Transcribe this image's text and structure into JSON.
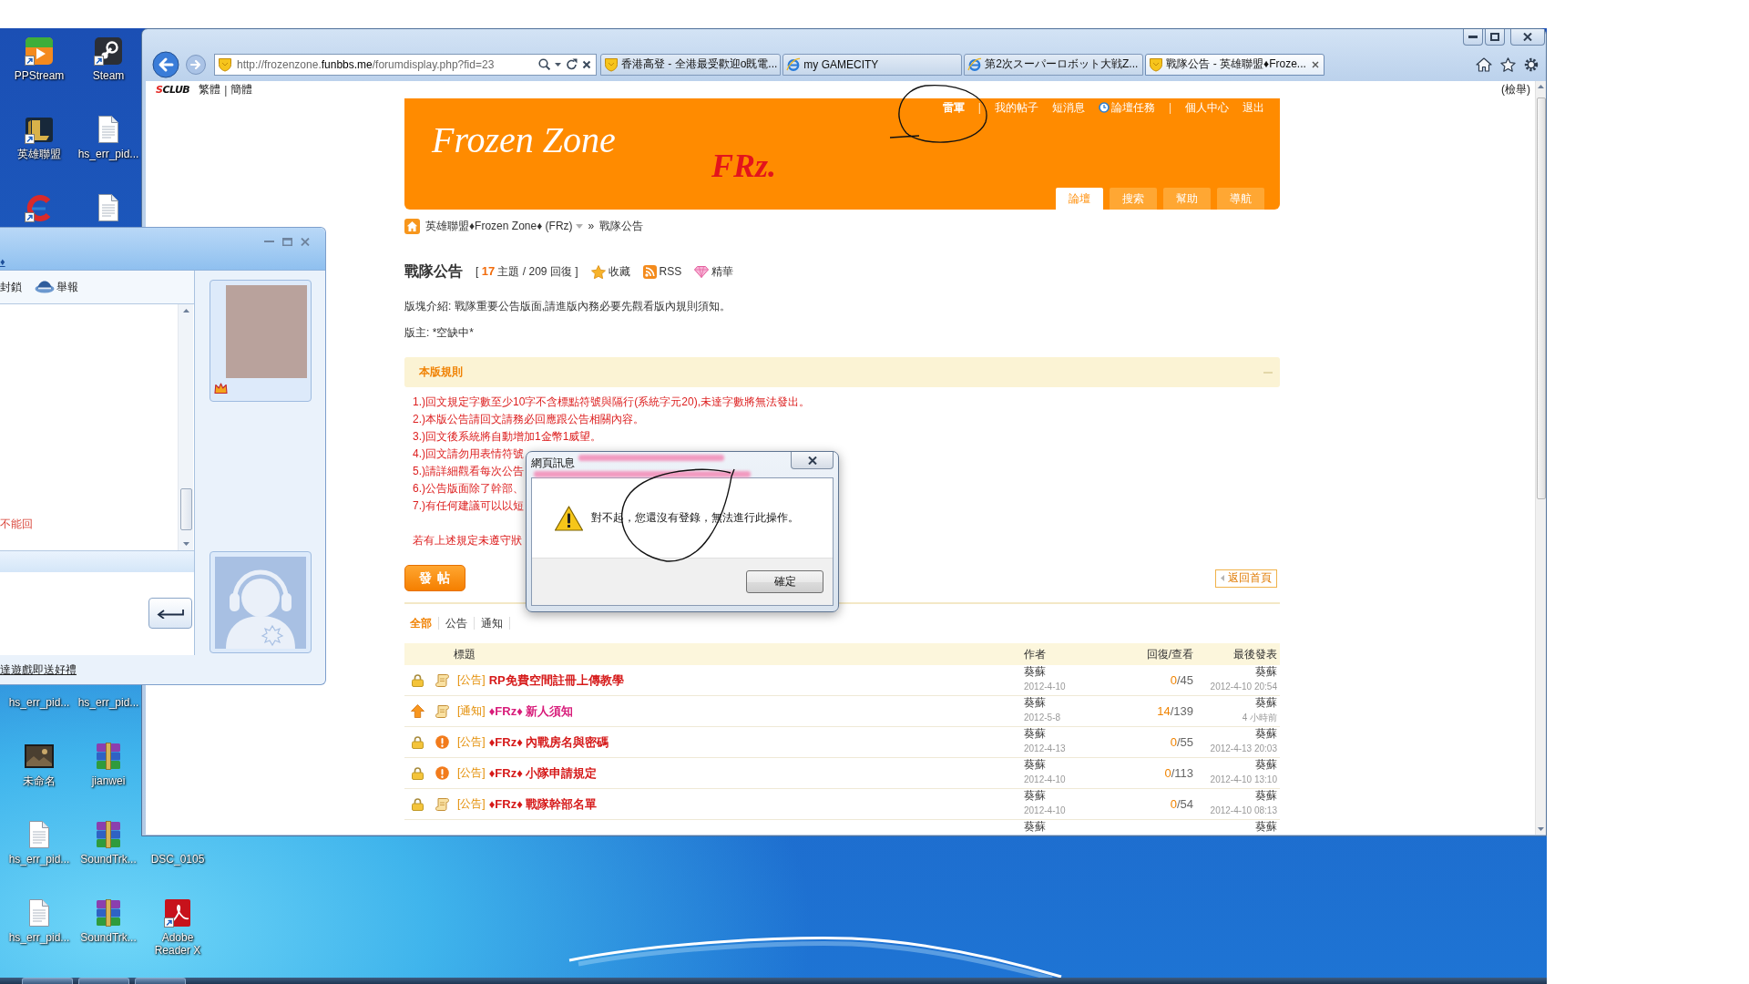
{
  "desktop": {
    "icons": [
      {
        "label": "PPStream",
        "kind": "player"
      },
      {
        "label": "Steam",
        "kind": "steam"
      },
      {
        "label": "英雄聯盟",
        "kind": "emblem"
      },
      {
        "label": "hs_err_pid...",
        "kind": "document"
      },
      {
        "kind": "cleaner"
      },
      {
        "kind": "document"
      },
      {
        "label": "hs_err_pid..."
      },
      {
        "label": "hs_err_pid..."
      },
      {
        "label": "未命名",
        "kind": "image"
      },
      {
        "label": "jianwei",
        "kind": "archive"
      },
      {
        "label": "hs_err_pid...",
        "kind": "document"
      },
      {
        "label": "SoundTrk...",
        "kind": "archive"
      },
      {
        "label": "DSC_0105"
      },
      {
        "label": "hs_err_pid...",
        "kind": "document"
      },
      {
        "label": "SoundTrk...",
        "kind": "archive"
      },
      {
        "label": "Adobe Reader X",
        "kind": "pdf"
      }
    ]
  },
  "browser": {
    "url": "http://frozenzone.**funbbs.me**/forumdisplay.php?fid=23",
    "tabs": [
      {
        "label": "香港高登 - 全港最受歡迎o既電...",
        "kind": "site",
        "selected": false
      },
      {
        "label": "my GAMECITY",
        "kind": "ie",
        "selected": false
      },
      {
        "label": "第2次スーパーロボット大戦Z...",
        "kind": "ie",
        "selected": false
      },
      {
        "label": "戰隊公告 - 英雄聯盟♦Froze...",
        "kind": "site",
        "selected": true
      }
    ],
    "toolbar": {
      "logo": "SCLUB",
      "links": [
        "繁體",
        "簡體"
      ],
      "separator": "|",
      "report": "(檢舉)"
    }
  },
  "forum": {
    "logo": "Frozen Zone",
    "tagline": "FRz.",
    "user_links": [
      {
        "kind": "user",
        "label": "雷軍"
      },
      {
        "kind": "separator",
        "label": "|"
      },
      {
        "kind": "link",
        "label": "我的帖子"
      },
      {
        "kind": "link",
        "label": "短消息"
      },
      {
        "kind": "task",
        "label": "論壇任務"
      },
      {
        "kind": "separator",
        "label": "|"
      },
      {
        "kind": "link",
        "label": "個人中心"
      },
      {
        "kind": "link",
        "label": "退出"
      }
    ],
    "nav": [
      {
        "label": "論壇",
        "selected": true
      },
      {
        "label": "搜索",
        "selected": false
      },
      {
        "label": "幫助",
        "selected": false
      },
      {
        "label": "導航",
        "selected": false
      }
    ],
    "breadcrumb": {
      "items": [
        "英雄聯盟♦Frozen Zone♦ (FRz)",
        "戰隊公告"
      ],
      "separator": "»"
    },
    "title": "戰隊公告",
    "stats": "[ **17** 主題 / 209 回復 ]",
    "actions": [
      {
        "label": "收藏",
        "kind": "star"
      },
      {
        "label": "RSS",
        "kind": "rss"
      },
      {
        "label": "精華",
        "kind": "gem"
      }
    ],
    "intro": "版塊介紹: 戰隊重要公告版面,請進版內務必要先觀看版內規則須知。",
    "moderator": "版主: *空缺中*",
    "rules": {
      "title": "本版規則",
      "lines": [
        "1.)回文規定字數至少10字不含標點符號與隔行(系統字元20),未達字數將無法發出。",
        "2.)本版公告請回文請務必回應跟公告相關內容。",
        "3.)回文後系統將自動增加1金幣1威望。",
        "4.)回文請勿用表情符號",
        "5.)請詳細觀看每次公告",
        "6.)公告版面除了幹部、",
        "7.)有任何建議可以以短"
      ],
      "note": "若有上述規定未遵守狀"
    },
    "post_button": "發 帖",
    "back_button": "返回首頁",
    "filters": [
      {
        "label": "全部",
        "selected": true
      },
      {
        "label": "公告",
        "selected": false
      },
      {
        "label": "通知",
        "selected": false
      }
    ],
    "table": {
      "columns": [
        "標題",
        "作者",
        "回復/查看",
        "最後發表"
      ],
      "rows": [
        {
          "icons": [
            {
              "kind": "lock"
            },
            {
              "kind": "scroll"
            }
          ],
          "type": "[公告]",
          "title": "RP免費空間註冊上傳教學",
          "color": "#d61a1a",
          "author": "葵蘇",
          "date": "2012-4-10",
          "counts": "**0**/45",
          "last_author": "葵蘇",
          "last_time": "2012-4-10 20:54"
        },
        {
          "icons": [
            {
              "kind": "arrow"
            },
            {
              "kind": "scroll"
            }
          ],
          "type": "[通知]",
          "title": "♦FRz♦ 新人須知",
          "color": "#d81c7a",
          "author": "葵蘇",
          "date": "2012-5-8",
          "counts": "**14**/139",
          "last_author": "葵蘇",
          "last_time": "4 小時前"
        },
        {
          "icons": [
            {
              "kind": "lock"
            },
            {
              "kind": "alert"
            }
          ],
          "type": "[公告]",
          "title": "♦FRz♦ 內戰房名與密碼",
          "color": "#d61a1a",
          "author": "葵蘇",
          "date": "2012-4-13",
          "counts": "**0**/55",
          "last_author": "葵蘇",
          "last_time": "2012-4-13 20:03"
        },
        {
          "icons": [
            {
              "kind": "lock"
            },
            {
              "kind": "alert"
            }
          ],
          "type": "[公告]",
          "title": "♦FRz♦ 小隊申請規定",
          "color": "#d61a1a",
          "author": "葵蘇",
          "date": "2012-4-10",
          "counts": "**0**/113",
          "last_author": "葵蘇",
          "last_time": "2012-4-10 13:10"
        },
        {
          "icons": [
            {
              "kind": "lock"
            },
            {
              "kind": "scroll"
            }
          ],
          "type": "[公告]",
          "title": "♦FRz♦ 戰隊幹部名單",
          "color": "#d61a1a",
          "author": "葵蘇",
          "date": "2012-4-10",
          "counts": "**0**/54",
          "last_author": "葵蘇",
          "last_time": "2012-4-10 08:13"
        },
        {
          "author": "葵蘇",
          "last_author": "葵蘇"
        }
      ]
    }
  },
  "dialog": {
    "title": "網頁訊息",
    "message": "對不起，您還沒有登錄，無法進行此操作。",
    "buttons": [
      "確定"
    ]
  },
  "chat": {
    "contact": "♦",
    "toolbar": [
      {
        "label": "封鎖",
        "kind": "text"
      },
      {
        "label": "舉報",
        "kind": "report"
      }
    ],
    "messages": [
      "不能回"
    ],
    "promo": "達遊戲即送好禮"
  }
}
